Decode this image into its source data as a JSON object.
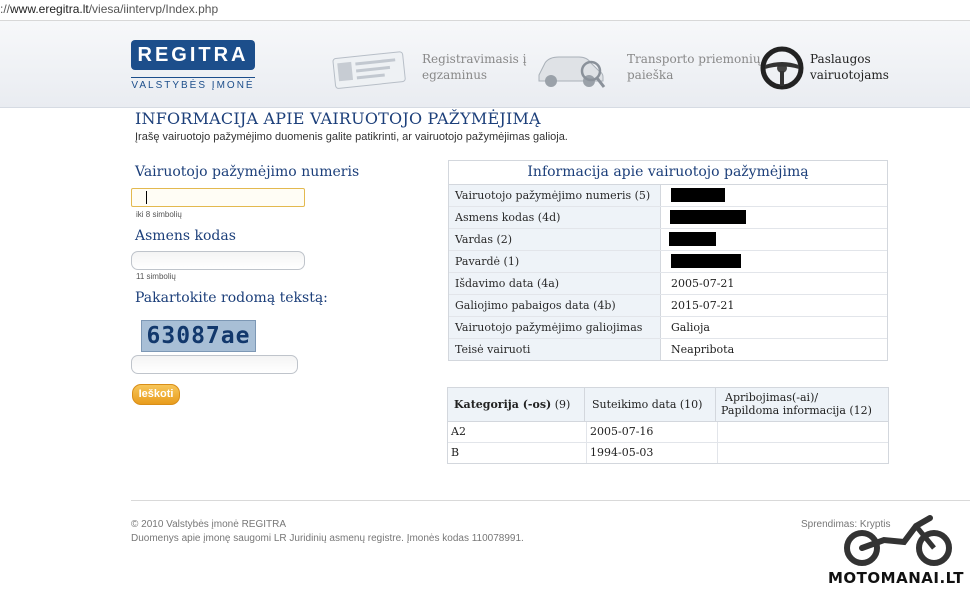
{
  "browser": {
    "url_prefix": "://",
    "url_host": "www.eregitra.lt",
    "url_path": "/viesa/iintervp/Index.php"
  },
  "header": {
    "logo_text": "REGITRA",
    "logo_sub": "VALSTYBĖS ĮMONĖ",
    "nav": [
      {
        "line1": "Registravimasis į",
        "line2": "egzaminus",
        "icon": "id-card-icon"
      },
      {
        "line1": "Transporto priemonių",
        "line2": "paieška",
        "icon": "car-search-icon"
      },
      {
        "line1": "Paslaugos",
        "line2": "vairuotojams",
        "icon": "steering-wheel-icon"
      }
    ]
  },
  "page": {
    "title": "INFORMACIJA APIE VAIRUOTOJO PAŽYMĖJIMĄ",
    "subtitle": "Įrašę vairuotojo pažymėjimo duomenis galite patikrinti, ar vairuotojo pažymėjimas galioja."
  },
  "form": {
    "license_label": "Vairuotojo pažymėjimo numeris",
    "license_hint": "iki 8 simbolių",
    "personal_label": "Asmens kodas",
    "personal_hint": "11 simbolių",
    "captcha_label": "Pakartokite rodomą tekstą:",
    "captcha_text": "63087ae",
    "search_button": "Ieškoti"
  },
  "info": {
    "heading": "Informacija apie vairuotojo pažymėjimą",
    "rows": [
      {
        "key": "Vairuotojo pažymėjimo numeris (5)",
        "value": "",
        "redacted": true
      },
      {
        "key": "Asmens kodas (4d)",
        "value": "",
        "redacted": true
      },
      {
        "key": "Vardas (2)",
        "value": "",
        "redacted": true
      },
      {
        "key": "Pavardė (1)",
        "value": "",
        "redacted": true
      },
      {
        "key": "Išdavimo data (4a)",
        "value": "2005-07-21"
      },
      {
        "key": "Galiojimo pabaigos data (4b)",
        "value": "2015-07-21"
      },
      {
        "key": "Vairuotojo pažymėjimo galiojimas",
        "value": "Galioja"
      },
      {
        "key": "Teisė vairuoti",
        "value": "Neapribota"
      }
    ]
  },
  "categories": {
    "headers": {
      "category_bold": "Kategorija (-os)",
      "category_num": "(9)",
      "date": "Suteikimo data (10)",
      "restrictions_line1": "Apribojimas(-ai)/",
      "restrictions_line2": "Papildoma informacija (12)"
    },
    "rows": [
      {
        "category": "A2",
        "date": "2005-07-16",
        "restrictions": ""
      },
      {
        "category": "B",
        "date": "1994-05-03",
        "restrictions": ""
      }
    ]
  },
  "footer": {
    "copyright": "© 2010 Valstybės įmonė REGITRA",
    "registry": "Duomenys apie įmonę saugomi LR Juridinių asmenų registre. Įmonės kodas 110078991.",
    "credit": "Sprendimas: Kryptis"
  },
  "watermark": "MOTOMANAI.LT"
}
